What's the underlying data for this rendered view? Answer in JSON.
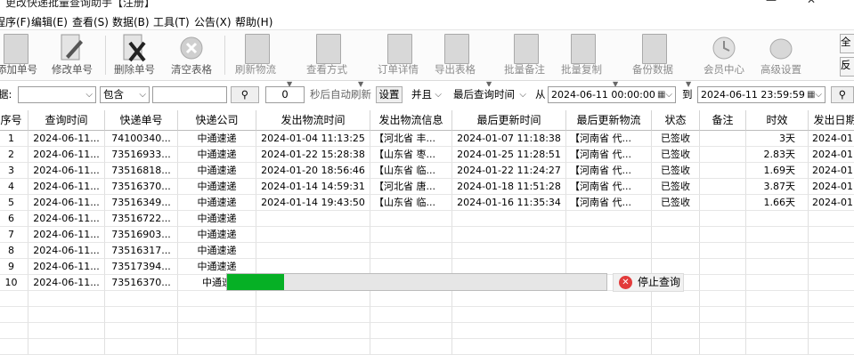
{
  "window": {
    "title": "更改快递批量查询助手【注册】",
    "minimize": "—",
    "close": "✕"
  },
  "menu": [
    "程序(F)",
    "编辑(E)",
    "查看(S)",
    "数据(B)",
    "工具(T)",
    "公告(X)",
    "帮助(H)"
  ],
  "toolbar": [
    {
      "label": "添加单号",
      "icon": "add-icon",
      "enabled": true
    },
    {
      "label": "修改单号",
      "icon": "edit-icon",
      "enabled": true
    },
    {
      "label": "删除单号",
      "icon": "delete-icon",
      "enabled": true
    },
    {
      "label": "清空表格",
      "icon": "clear-icon",
      "enabled": true
    },
    {
      "label": "刷新物流",
      "icon": "refresh-icon",
      "enabled": false
    },
    {
      "label": "查看方式",
      "icon": "view-icon",
      "enabled": false
    },
    {
      "label": "订单详情",
      "icon": "detail-icon",
      "enabled": false
    },
    {
      "label": "导出表格",
      "icon": "export-icon",
      "enabled": false
    },
    {
      "label": "批量备注",
      "icon": "note-icon",
      "enabled": false
    },
    {
      "label": "批量复制",
      "icon": "copy-icon",
      "enabled": false
    },
    {
      "label": "备份数据",
      "icon": "backup-icon",
      "enabled": false
    },
    {
      "label": "会员中心",
      "icon": "member-icon",
      "enabled": false
    },
    {
      "label": "高级设置",
      "icon": "settings-icon",
      "enabled": false
    }
  ],
  "side_buttons": [
    "全",
    "反"
  ],
  "filter": {
    "field_label": "据:",
    "match_mode": "包含",
    "keyword": "",
    "search_icon": "search-icon",
    "seconds": "0",
    "auto_refresh_label": "秒后自动刷新",
    "settings_button": "设置",
    "logic": "并且",
    "time_field": "最后查询时间",
    "from_label": "从",
    "from_date": "2024-06-11 00:00:00",
    "to_label": "到",
    "to_date": "2024-06-11 23:59:59"
  },
  "table": {
    "columns": [
      "序号",
      "查询时间",
      "快递单号",
      "快递公司",
      "发出物流时间",
      "发出物流信息",
      "最后更新时间",
      "最后更新物流",
      "状态",
      "备注",
      "时效",
      "发出日期"
    ],
    "rows": [
      [
        "1",
        "2024-06-11...",
        "74100340...",
        "中通速递",
        "2024-01-04 11:13:25",
        "【河北省 丰...",
        "2024-01-07 11:18:38",
        "【河南省 代...",
        "已签收",
        "",
        "3天",
        "2024-01"
      ],
      [
        "2",
        "2024-06-11...",
        "73516933...",
        "中通速递",
        "2024-01-22 15:28:38",
        "【山东省 枣...",
        "2024-01-25 11:28:51",
        "【河南省 代...",
        "已签收",
        "",
        "2.83天",
        "2024-01"
      ],
      [
        "3",
        "2024-06-11...",
        "73516818...",
        "中通速递",
        "2024-01-20 18:56:46",
        "【山东省 临...",
        "2024-01-22 11:24:27",
        "【河南省 代...",
        "已签收",
        "",
        "1.69天",
        "2024-01"
      ],
      [
        "4",
        "2024-06-11...",
        "73516370...",
        "中通速递",
        "2024-01-14 14:59:31",
        "【河北省 唐...",
        "2024-01-18 11:51:28",
        "【河南省 代...",
        "已签收",
        "",
        "3.87天",
        "2024-01"
      ],
      [
        "5",
        "2024-06-11...",
        "73516349...",
        "中通速递",
        "2024-01-14 19:43:50",
        "【山东省 临...",
        "2024-01-16 11:35:34",
        "【河南省 代...",
        "已签收",
        "",
        "1.66天",
        "2024-01"
      ],
      [
        "6",
        "2024-06-11...",
        "73516722...",
        "中通速递",
        "",
        "",
        "",
        "",
        "",
        "",
        "",
        ""
      ],
      [
        "7",
        "2024-06-11...",
        "73516903...",
        "中通速递",
        "",
        "",
        "",
        "",
        "",
        "",
        "",
        ""
      ],
      [
        "8",
        "2024-06-11...",
        "73516317...",
        "中通速递",
        "",
        "",
        "",
        "",
        "",
        "",
        "",
        ""
      ],
      [
        "9",
        "2024-06-11...",
        "73517394...",
        "中通速递",
        "",
        "",
        "",
        "",
        "",
        "",
        "",
        ""
      ],
      [
        "10",
        "2024-06-11...",
        "73516370...",
        "中通速",
        "",
        "",
        "",
        "",
        "",
        "",
        "",
        ""
      ]
    ]
  },
  "progress": {
    "percent": 15
  },
  "stop_button": {
    "label": "停止查询",
    "icon": "stop-icon"
  },
  "colors": {
    "progress_fill": "#06b025",
    "stop_icon": "#e23b3b"
  }
}
